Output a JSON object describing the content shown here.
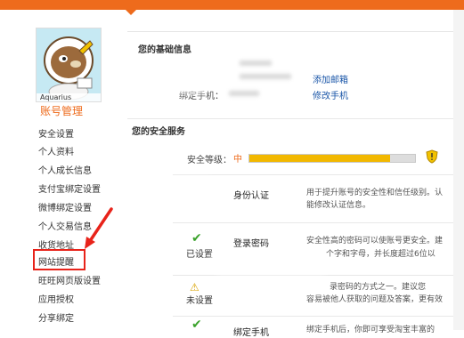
{
  "topbar": {
    "color": "#ee6b1c"
  },
  "sidebar": {
    "avatar_caption": "Aquarius",
    "section_title": "账号管理",
    "items": [
      {
        "label": "安全设置"
      },
      {
        "label": "个人资料"
      },
      {
        "label": "个人成长信息"
      },
      {
        "label": "支付宝绑定设置"
      },
      {
        "label": "微博绑定设置"
      },
      {
        "label": "个人交易信息"
      },
      {
        "label": "收货地址"
      },
      {
        "label": "网站提醒",
        "highlighted": true
      },
      {
        "label": "旺旺网页版设置"
      },
      {
        "label": "应用授权"
      },
      {
        "label": "分享绑定"
      }
    ],
    "highlight_color": "#e8231a"
  },
  "basic_info": {
    "title": "您的基础信息",
    "add_email_link": "添加邮箱",
    "phone_label": "绑定手机：",
    "change_phone_link": "修改手机"
  },
  "security": {
    "title": "您的安全服务",
    "level_label": "安全等级：",
    "level_value": "中",
    "level_fraction": 0.85,
    "services": [
      {
        "name": "身份认证",
        "status": "",
        "icon": "none",
        "desc_line1": "用于提升账号的安全性和信任级别。认",
        "desc_line2": "能修改认证信息。"
      },
      {
        "name": "登录密码",
        "status": "已设置",
        "icon": "check-icon",
        "desc_line1": "安全性高的密码可以使账号更安全。建",
        "desc_line2": "个字和字母，并长度超过6位以"
      },
      {
        "name": "",
        "status": "未设置",
        "icon": "warning-icon",
        "desc_line1": "录密码的方式之一。建议您",
        "desc_line2": "容易被他人获取的问题及答案，更有效"
      },
      {
        "name": "绑定手机",
        "status": "",
        "icon": "check-icon",
        "desc_line1": "绑定手机后，你即可享受淘宝丰富的",
        "desc_line2": ""
      }
    ]
  },
  "colors": {
    "accent": "#ee6b1c",
    "link": "#1a56a8",
    "bar_fill": "#f2b800"
  }
}
